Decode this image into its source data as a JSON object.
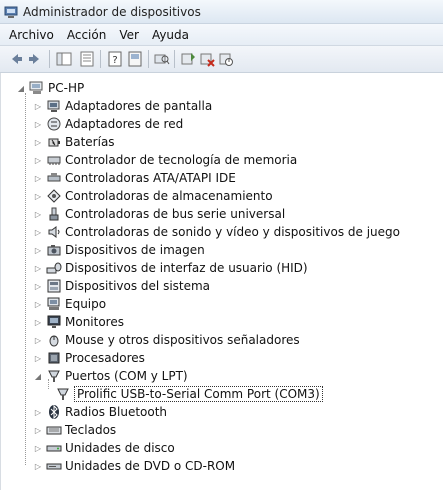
{
  "window": {
    "title": "Administrador de dispositivos"
  },
  "menu": {
    "items": [
      "Archivo",
      "Acción",
      "Ver",
      "Ayuda"
    ]
  },
  "toolbar": {
    "buttons": [
      "back-icon",
      "forward-icon",
      "show-hide-tree-icon",
      "properties-icon",
      "help-icon",
      "view-icon",
      "scan-hardware-icon",
      "update-driver-icon",
      "uninstall-icon",
      "disable-icon"
    ]
  },
  "tree": {
    "root": "PC-HP",
    "categories": [
      {
        "label": "Adaptadores de pantalla",
        "icon": "display-adapter-icon"
      },
      {
        "label": "Adaptadores de red",
        "icon": "network-adapter-icon"
      },
      {
        "label": "Baterías",
        "icon": "battery-icon"
      },
      {
        "label": "Controlador de tecnología de memoria",
        "icon": "memory-controller-icon"
      },
      {
        "label": "Controladoras ATA/ATAPI IDE",
        "icon": "ide-controller-icon"
      },
      {
        "label": "Controladoras de almacenamiento",
        "icon": "storage-controller-icon"
      },
      {
        "label": "Controladoras de bus serie universal",
        "icon": "usb-controller-icon"
      },
      {
        "label": "Controladoras de sonido y vídeo y dispositivos de juego",
        "icon": "sound-icon"
      },
      {
        "label": "Dispositivos de imagen",
        "icon": "camera-icon"
      },
      {
        "label": "Dispositivos de interfaz de usuario (HID)",
        "icon": "hid-icon"
      },
      {
        "label": "Dispositivos del sistema",
        "icon": "system-device-icon"
      },
      {
        "label": "Equipo",
        "icon": "computer-icon"
      },
      {
        "label": "Monitores",
        "icon": "monitor-icon"
      },
      {
        "label": "Mouse y otros dispositivos señaladores",
        "icon": "mouse-icon"
      },
      {
        "label": "Procesadores",
        "icon": "processor-icon"
      },
      {
        "label": "Puertos (COM y LPT)",
        "icon": "port-icon",
        "expanded": true,
        "children": [
          "Prolific USB-to-Serial Comm Port (COM3)"
        ]
      },
      {
        "label": "Radios Bluetooth",
        "icon": "bluetooth-icon"
      },
      {
        "label": "Teclados",
        "icon": "keyboard-icon"
      },
      {
        "label": "Unidades de disco",
        "icon": "disk-drive-icon"
      },
      {
        "label": "Unidades de DVD o CD-ROM",
        "icon": "dvd-icon"
      }
    ]
  }
}
